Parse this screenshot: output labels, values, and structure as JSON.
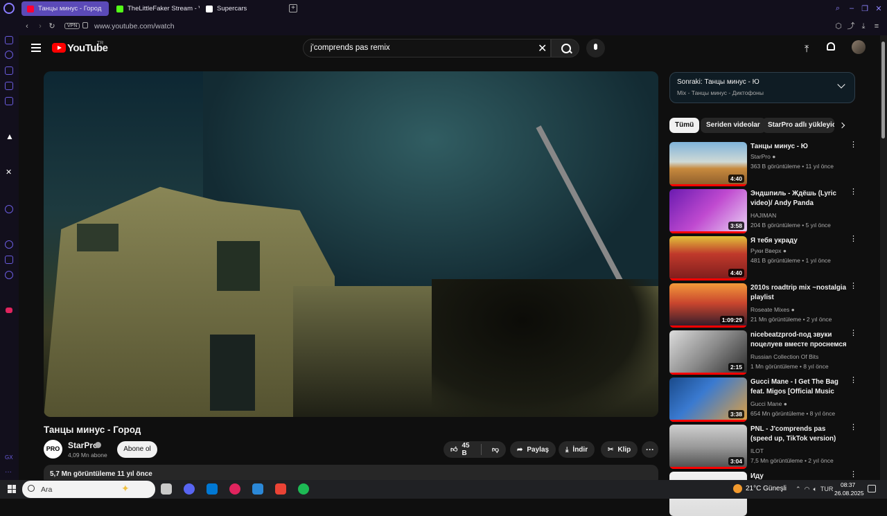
{
  "browser": {
    "tabs": [
      {
        "label": "Танцы минус - Город",
        "active": true,
        "favicon_color": "#ff0033"
      },
      {
        "label": "TheLittleFaker Stream - V",
        "active": false,
        "favicon_color": "#53fc18"
      },
      {
        "label": "Supercars",
        "active": false,
        "favicon_color": "#ffffff"
      }
    ],
    "vpn_label": "VPN",
    "url": "www.youtube.com/watch"
  },
  "youtube": {
    "wordmark": "YouTube",
    "country": "TR",
    "search_query": "j'comprends pas remix",
    "video": {
      "title": "Танцы минус - Город",
      "channel": "StarPro",
      "channel_avatar_text": "PRO",
      "subscribers": "4,09 Mn abone",
      "subscribe_label": "Abone ol",
      "likes": "45 B",
      "share_label": "Paylaş",
      "download_label": "İndir",
      "clip_label": "Klip",
      "more_label": "···",
      "description_stats": "5,7 Mn görüntüleme  11 yıl önce"
    },
    "up_next": {
      "label": "Sonraki: Танцы минус - Ю",
      "subtitle": "Mix - Танцы минус - Диктофоны"
    },
    "chips": [
      "Tümü",
      "Seriden videolar",
      "StarPro adlı yükleyici"
    ],
    "recommendations": [
      {
        "title": "Танцы минус - Ю",
        "channel": "StarPro",
        "verified": true,
        "meta": "363 B görüntüleme • 11 yıl önce",
        "duration": "4:40",
        "thumb": "linear-gradient(180deg,#7fb3d9 0%,#cfd9d6 45%,#c78a3e 60%,#8a5a2a 100%)"
      },
      {
        "title": "Эндшпиль - Ждёшь (Lyric video)/ Andy Panda",
        "channel": "HAJIMAN",
        "verified": false,
        "meta": "204 B görüntüleme • 5 yıl önce",
        "duration": "3:58",
        "thumb": "linear-gradient(135deg,#6a1bb0 0%,#c04ad0 50%,#e9d6f5 100%)"
      },
      {
        "title": "Я тебя украду",
        "channel": "Руки Вверх",
        "verified": true,
        "meta": "481 B görüntüleme • 1 yıl önce",
        "duration": "4:40",
        "thumb": "linear-gradient(180deg,#e2c23a 0%,#c0392b 40%,#7a1c1c 100%)"
      },
      {
        "title": "2010s roadtrip mix ~nostalgia playlist",
        "channel": "Roseate Mixes",
        "verified": true,
        "meta": "21 Mn görüntüleme • 2 yıl önce",
        "duration": "1:09:29",
        "thumb": "linear-gradient(180deg,#f39a3a 0%,#c9452e 45%,#2a1a2a 100%)"
      },
      {
        "title": "nicebeatzprod-под звуки поцелуев вместе проснемся",
        "channel": "Russian Collection Of Bits",
        "verified": false,
        "meta": "1 Mn görüntüleme • 8 yıl önce",
        "duration": "2:15",
        "thumb": "linear-gradient(135deg,#dcdcdc 0%,#8a8a8a 50%,#2a2a2a 100%)"
      },
      {
        "title": "Gucci Mane - I Get The Bag feat. Migos [Official Music Video]",
        "channel": "Gucci Mane",
        "verified": true,
        "meta": "654 Mn görüntüleme • 8 yıl önce",
        "duration": "3:38",
        "thumb": "linear-gradient(135deg,#1a4a8a 0%,#3a7ad0 40%,#e0a040 100%)"
      },
      {
        "title": "PNL - J'comprends pas (speed up, TikTok version)",
        "channel": "ILOT",
        "verified": false,
        "meta": "7,5 Mn görüntüleme • 2 yıl önce",
        "duration": "3:04",
        "thumb": "linear-gradient(180deg,#cfcfcf 0%,#9a9a9a 50%,#4a4a4a 100%)"
      },
      {
        "title": "Иду",
        "channel": "",
        "verified": false,
        "meta": "",
        "duration": "",
        "thumb": "linear-gradient(180deg,#f2f2f2 0%,#dcdcdc 100%)"
      }
    ]
  },
  "taskbar": {
    "search_label": "Ara",
    "weather": "21°C  Güneşli",
    "lang": "TUR",
    "time": "08:37",
    "date": "26.08.2025",
    "app_colors": [
      "#c9c9c9",
      "#5865f2",
      "#0078d4",
      "#e0245e",
      "#2b88d8",
      "#ea4335",
      "#1db954"
    ]
  }
}
